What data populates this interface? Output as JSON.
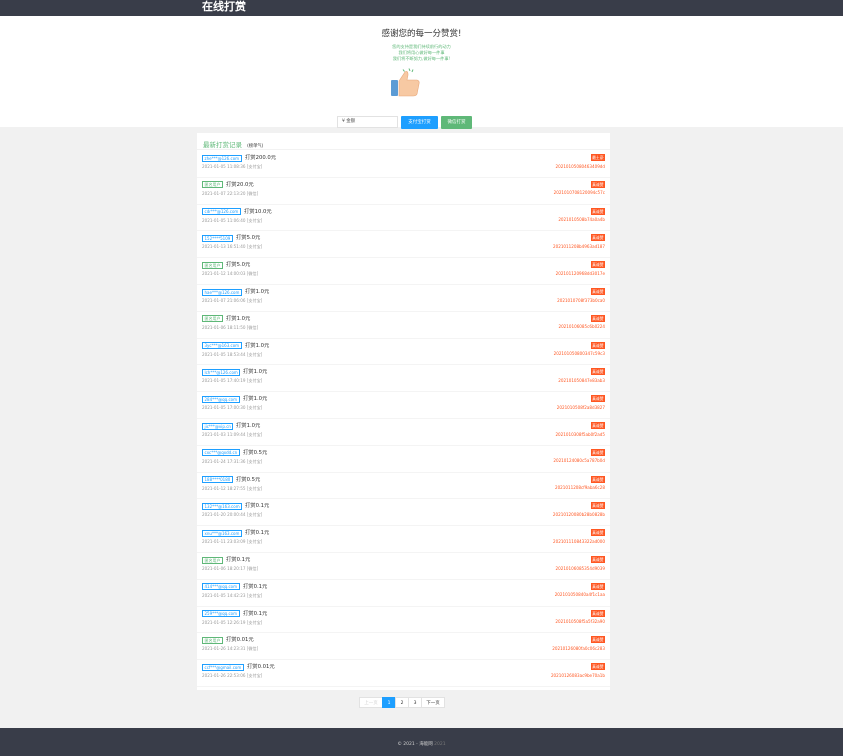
{
  "header": {
    "brand": "在线打赏"
  },
  "hero": {
    "title": "感谢您的每一分赞赏!",
    "desc_lines": [
      "您的支持是我们持续前行的动力",
      "我们将用心做好每一件事",
      "我们将不断努力,做好每一件事!"
    ],
    "amount_value": "¥ 金额",
    "alipay_label": "支付宝打赏",
    "wechat_label": "微信打赏",
    "thumb_icon": "thumbs-up-icon"
  },
  "records": {
    "title": "最新打赏记录",
    "subtitle": "(榜单气)",
    "items": [
      {
        "user": "zhe***@126.com",
        "anon": false,
        "amount": "打赏200.0元",
        "time": "2021-01-05 11:08:36",
        "method": "[支付宝]",
        "badge": "最土豪",
        "order": "20210105080463409dd"
      },
      {
        "user": "匿名用户",
        "anon": true,
        "amount": "打赏20.0元",
        "time": "2021-01-07 22:13:20",
        "method": "[微信]",
        "badge": "真诚赞",
        "order": "2021010708120094c57c"
      },
      {
        "user": "cdr***@126.com",
        "anon": false,
        "amount": "打赏10.0元",
        "time": "2021-01-05 11:06:40",
        "method": "[支付宝]",
        "badge": "真诚赞",
        "order": "2021010508b74a0a4b"
      },
      {
        "user": "152****5109",
        "anon": false,
        "amount": "打赏5.0元",
        "time": "2021-01-13 16:51:40",
        "method": "[支付宝]",
        "badge": "真诚赞",
        "order": "2021011208b4963ad187"
      },
      {
        "user": "匿名用户",
        "anon": true,
        "amount": "打赏5.0元",
        "time": "2021-01-12 14:00:03",
        "method": "[微信]",
        "badge": "真诚赞",
        "order": "202101120968dd3017e"
      },
      {
        "user": "hae***@126.com",
        "anon": false,
        "amount": "打赏1.0元",
        "time": "2021-01-07 21:06:06",
        "method": "[支付宝]",
        "badge": "真诚赞",
        "order": "2021010708f373b0ca0"
      },
      {
        "user": "匿名用户",
        "anon": true,
        "amount": "打赏1.0元",
        "time": "2021-01-06 18:11:50",
        "method": "[微信]",
        "badge": "真诚赞",
        "order": "20210106085c6b0224"
      },
      {
        "user": "3yc***@163.com",
        "anon": false,
        "amount": "打赏1.0元",
        "time": "2021-01-05 18:53:44",
        "method": "[支付宝]",
        "badge": "真诚赞",
        "order": "202101050800347c59c3"
      },
      {
        "user": "lch***@126.com",
        "anon": false,
        "amount": "打赏1.0元",
        "time": "2021-01-05 17:40:19",
        "method": "[支付宝]",
        "badge": "真诚赞",
        "order": "202101050847e83ab3"
      },
      {
        "user": "284***@qq.com",
        "anon": false,
        "amount": "打赏1.0元",
        "time": "2021-01-05 17:00:30",
        "method": "[支付宝]",
        "badge": "真诚赞",
        "order": "2021010508f2a8d3827"
      },
      {
        "user": "jic***@vip.cn",
        "anon": false,
        "amount": "打赏1.0元",
        "time": "2021-01-03 11:09:44",
        "method": "[支付宝]",
        "badge": "真诚赞",
        "order": "2021010308f5ab0f2ad5"
      },
      {
        "user": "cxc***@qxdd.cn",
        "anon": false,
        "amount": "打赏0.5元",
        "time": "2021-01-24 17:31:36",
        "method": "[支付宝]",
        "badge": "真诚赞",
        "order": "20210124080c5a787b0d"
      },
      {
        "user": "188****0180",
        "anon": false,
        "amount": "打赏0.5元",
        "time": "2021-01-12 18:27:55",
        "method": "[支付宝]",
        "badge": "真诚赞",
        "order": "2021011208cf9aba6c28"
      },
      {
        "user": "132***@163.com",
        "anon": false,
        "amount": "打赏0.1元",
        "time": "2021-01-20 20:00:44",
        "method": "[支付宝]",
        "badge": "真诚赞",
        "order": "20210120080b28b0828b"
      },
      {
        "user": "xnu***@163.com",
        "anon": false,
        "amount": "打赏0.1元",
        "time": "2021-01-11 23:03:09",
        "method": "[支付宝]",
        "badge": "真诚赞",
        "order": "202101110843322ad000"
      },
      {
        "user": "匿名用户",
        "anon": true,
        "amount": "打赏0.1元",
        "time": "2021-01-06 18:20:17",
        "method": "[微信]",
        "badge": "真诚赞",
        "order": "20210106085354d9039"
      },
      {
        "user": "414***@qq.com",
        "anon": false,
        "amount": "打赏0.1元",
        "time": "2021-01-05 14:42:23",
        "method": "[支付宝]",
        "badge": "真诚赞",
        "order": "202101050840a4f1c1aa"
      },
      {
        "user": "259***@qq.com",
        "anon": false,
        "amount": "打赏0.1元",
        "time": "2021-01-05 12:26:19",
        "method": "[支付宝]",
        "badge": "真诚赞",
        "order": "2021010508f5a5f32a90"
      },
      {
        "user": "匿名用户",
        "anon": true,
        "amount": "打赏0.01元",
        "time": "2021-01-26 14:23:31",
        "method": "[微信]",
        "badge": "真诚赞",
        "order": "20210126080fa0c06c283"
      },
      {
        "user": "ccf***@gmail.com",
        "anon": false,
        "amount": "打赏0.01元",
        "time": "2021-01-26 22:53:06",
        "method": "[支付宝]",
        "badge": "真诚赞",
        "order": "20210126083ac9be70a1b"
      }
    ]
  },
  "pager": {
    "prev": "上一页",
    "pages": [
      "1",
      "2",
      "3"
    ],
    "current": "1",
    "next": "下一页"
  },
  "footer": {
    "copyright": "© 2021 - 海能网",
    "version": "2021"
  },
  "colors": {
    "header": "#393d49",
    "blue": "#1e9fff",
    "green": "#5fb878",
    "orange": "#ff5722"
  }
}
